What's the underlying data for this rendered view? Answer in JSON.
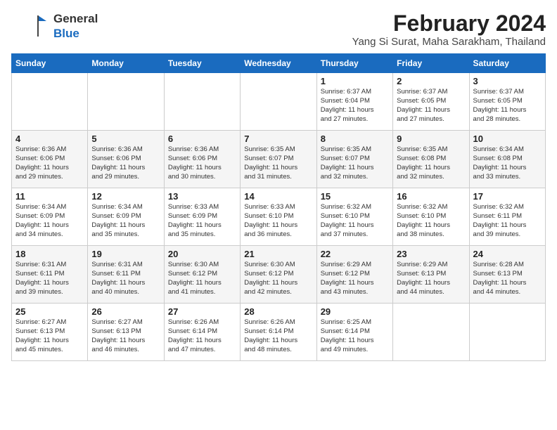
{
  "logo": {
    "general": "General",
    "blue": "Blue"
  },
  "title": "February 2024",
  "location": "Yang Si Surat, Maha Sarakham, Thailand",
  "weekdays": [
    "Sunday",
    "Monday",
    "Tuesday",
    "Wednesday",
    "Thursday",
    "Friday",
    "Saturday"
  ],
  "weeks": [
    [
      {
        "day": "",
        "info": ""
      },
      {
        "day": "",
        "info": ""
      },
      {
        "day": "",
        "info": ""
      },
      {
        "day": "",
        "info": ""
      },
      {
        "day": "1",
        "info": "Sunrise: 6:37 AM\nSunset: 6:04 PM\nDaylight: 11 hours\nand 27 minutes."
      },
      {
        "day": "2",
        "info": "Sunrise: 6:37 AM\nSunset: 6:05 PM\nDaylight: 11 hours\nand 27 minutes."
      },
      {
        "day": "3",
        "info": "Sunrise: 6:37 AM\nSunset: 6:05 PM\nDaylight: 11 hours\nand 28 minutes."
      }
    ],
    [
      {
        "day": "4",
        "info": "Sunrise: 6:36 AM\nSunset: 6:06 PM\nDaylight: 11 hours\nand 29 minutes."
      },
      {
        "day": "5",
        "info": "Sunrise: 6:36 AM\nSunset: 6:06 PM\nDaylight: 11 hours\nand 29 minutes."
      },
      {
        "day": "6",
        "info": "Sunrise: 6:36 AM\nSunset: 6:06 PM\nDaylight: 11 hours\nand 30 minutes."
      },
      {
        "day": "7",
        "info": "Sunrise: 6:35 AM\nSunset: 6:07 PM\nDaylight: 11 hours\nand 31 minutes."
      },
      {
        "day": "8",
        "info": "Sunrise: 6:35 AM\nSunset: 6:07 PM\nDaylight: 11 hours\nand 32 minutes."
      },
      {
        "day": "9",
        "info": "Sunrise: 6:35 AM\nSunset: 6:08 PM\nDaylight: 11 hours\nand 32 minutes."
      },
      {
        "day": "10",
        "info": "Sunrise: 6:34 AM\nSunset: 6:08 PM\nDaylight: 11 hours\nand 33 minutes."
      }
    ],
    [
      {
        "day": "11",
        "info": "Sunrise: 6:34 AM\nSunset: 6:09 PM\nDaylight: 11 hours\nand 34 minutes."
      },
      {
        "day": "12",
        "info": "Sunrise: 6:34 AM\nSunset: 6:09 PM\nDaylight: 11 hours\nand 35 minutes."
      },
      {
        "day": "13",
        "info": "Sunrise: 6:33 AM\nSunset: 6:09 PM\nDaylight: 11 hours\nand 35 minutes."
      },
      {
        "day": "14",
        "info": "Sunrise: 6:33 AM\nSunset: 6:10 PM\nDaylight: 11 hours\nand 36 minutes."
      },
      {
        "day": "15",
        "info": "Sunrise: 6:32 AM\nSunset: 6:10 PM\nDaylight: 11 hours\nand 37 minutes."
      },
      {
        "day": "16",
        "info": "Sunrise: 6:32 AM\nSunset: 6:10 PM\nDaylight: 11 hours\nand 38 minutes."
      },
      {
        "day": "17",
        "info": "Sunrise: 6:32 AM\nSunset: 6:11 PM\nDaylight: 11 hours\nand 39 minutes."
      }
    ],
    [
      {
        "day": "18",
        "info": "Sunrise: 6:31 AM\nSunset: 6:11 PM\nDaylight: 11 hours\nand 39 minutes."
      },
      {
        "day": "19",
        "info": "Sunrise: 6:31 AM\nSunset: 6:11 PM\nDaylight: 11 hours\nand 40 minutes."
      },
      {
        "day": "20",
        "info": "Sunrise: 6:30 AM\nSunset: 6:12 PM\nDaylight: 11 hours\nand 41 minutes."
      },
      {
        "day": "21",
        "info": "Sunrise: 6:30 AM\nSunset: 6:12 PM\nDaylight: 11 hours\nand 42 minutes."
      },
      {
        "day": "22",
        "info": "Sunrise: 6:29 AM\nSunset: 6:12 PM\nDaylight: 11 hours\nand 43 minutes."
      },
      {
        "day": "23",
        "info": "Sunrise: 6:29 AM\nSunset: 6:13 PM\nDaylight: 11 hours\nand 44 minutes."
      },
      {
        "day": "24",
        "info": "Sunrise: 6:28 AM\nSunset: 6:13 PM\nDaylight: 11 hours\nand 44 minutes."
      }
    ],
    [
      {
        "day": "25",
        "info": "Sunrise: 6:27 AM\nSunset: 6:13 PM\nDaylight: 11 hours\nand 45 minutes."
      },
      {
        "day": "26",
        "info": "Sunrise: 6:27 AM\nSunset: 6:13 PM\nDaylight: 11 hours\nand 46 minutes."
      },
      {
        "day": "27",
        "info": "Sunrise: 6:26 AM\nSunset: 6:14 PM\nDaylight: 11 hours\nand 47 minutes."
      },
      {
        "day": "28",
        "info": "Sunrise: 6:26 AM\nSunset: 6:14 PM\nDaylight: 11 hours\nand 48 minutes."
      },
      {
        "day": "29",
        "info": "Sunrise: 6:25 AM\nSunset: 6:14 PM\nDaylight: 11 hours\nand 49 minutes."
      },
      {
        "day": "",
        "info": ""
      },
      {
        "day": "",
        "info": ""
      }
    ]
  ]
}
